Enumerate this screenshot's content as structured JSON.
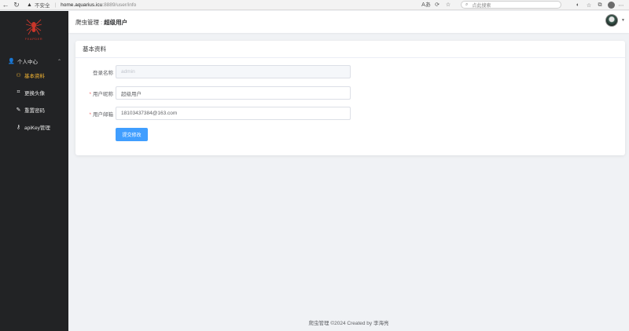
{
  "browser": {
    "not_secure": "不安全",
    "url_host": "home.aquarius.icu",
    "url_rest": ":8889/user/info",
    "search_placeholder": "点此搜索",
    "read_aloud": "Aあ"
  },
  "logo": {
    "text": "FEAPDER"
  },
  "sidebar": {
    "group_label": "个人中心",
    "items": [
      {
        "label": "基本资料",
        "active": true
      },
      {
        "label": "更换头像"
      },
      {
        "label": "重置密码"
      },
      {
        "label": "apiKey管理"
      }
    ]
  },
  "header": {
    "breadcrumb_parent": "爬虫管理",
    "breadcrumb_sep": ":",
    "breadcrumb_current": "超级用户"
  },
  "card": {
    "title": "基本资料",
    "fields": {
      "login_name": {
        "label": "登录名称",
        "value": "admin"
      },
      "nickname": {
        "label": "用户昵称",
        "value": "超级用户"
      },
      "email": {
        "label": "用户邮箱",
        "value": "18103437384@163.com"
      }
    },
    "submit_label": "提交修改"
  },
  "footer": {
    "text": "爬虫管理 ©2024 Created by 李海亮"
  },
  "colors": {
    "accent": "#409eff",
    "sidebar_bg": "#222325",
    "active_menu": "#f7b733",
    "required": "#f56c6c"
  }
}
